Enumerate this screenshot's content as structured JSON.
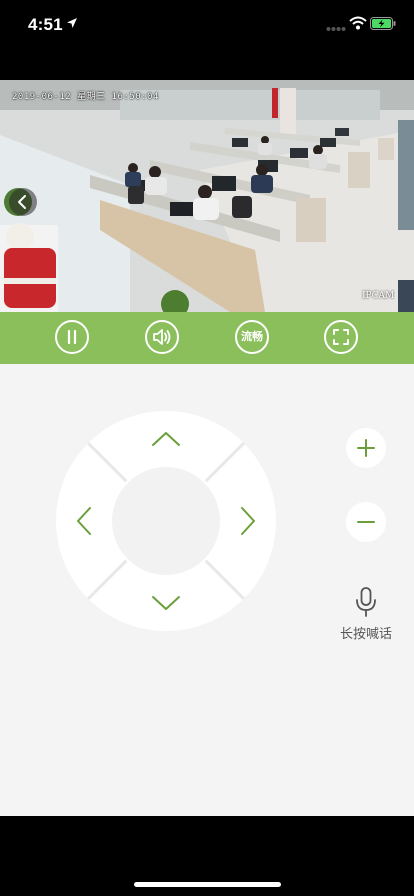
{
  "status_bar": {
    "time": "4:51"
  },
  "video": {
    "timestamp": "2019-06-12 星期三 16:50:04",
    "brand": "IPCAM"
  },
  "controls": {
    "fluency_label": "流畅"
  },
  "talk": {
    "label": "长按喊话"
  },
  "colors": {
    "accent": "#8bbf5c",
    "arrow": "#6a9f3a",
    "panel_bg": "#f4f4f4"
  },
  "icons": {
    "back": "chevron-left-icon",
    "pause": "pause-icon",
    "sound": "speaker-icon",
    "fullscreen": "fullscreen-icon",
    "zoom_in": "plus-icon",
    "zoom_out": "minus-icon",
    "mic": "microphone-icon"
  }
}
